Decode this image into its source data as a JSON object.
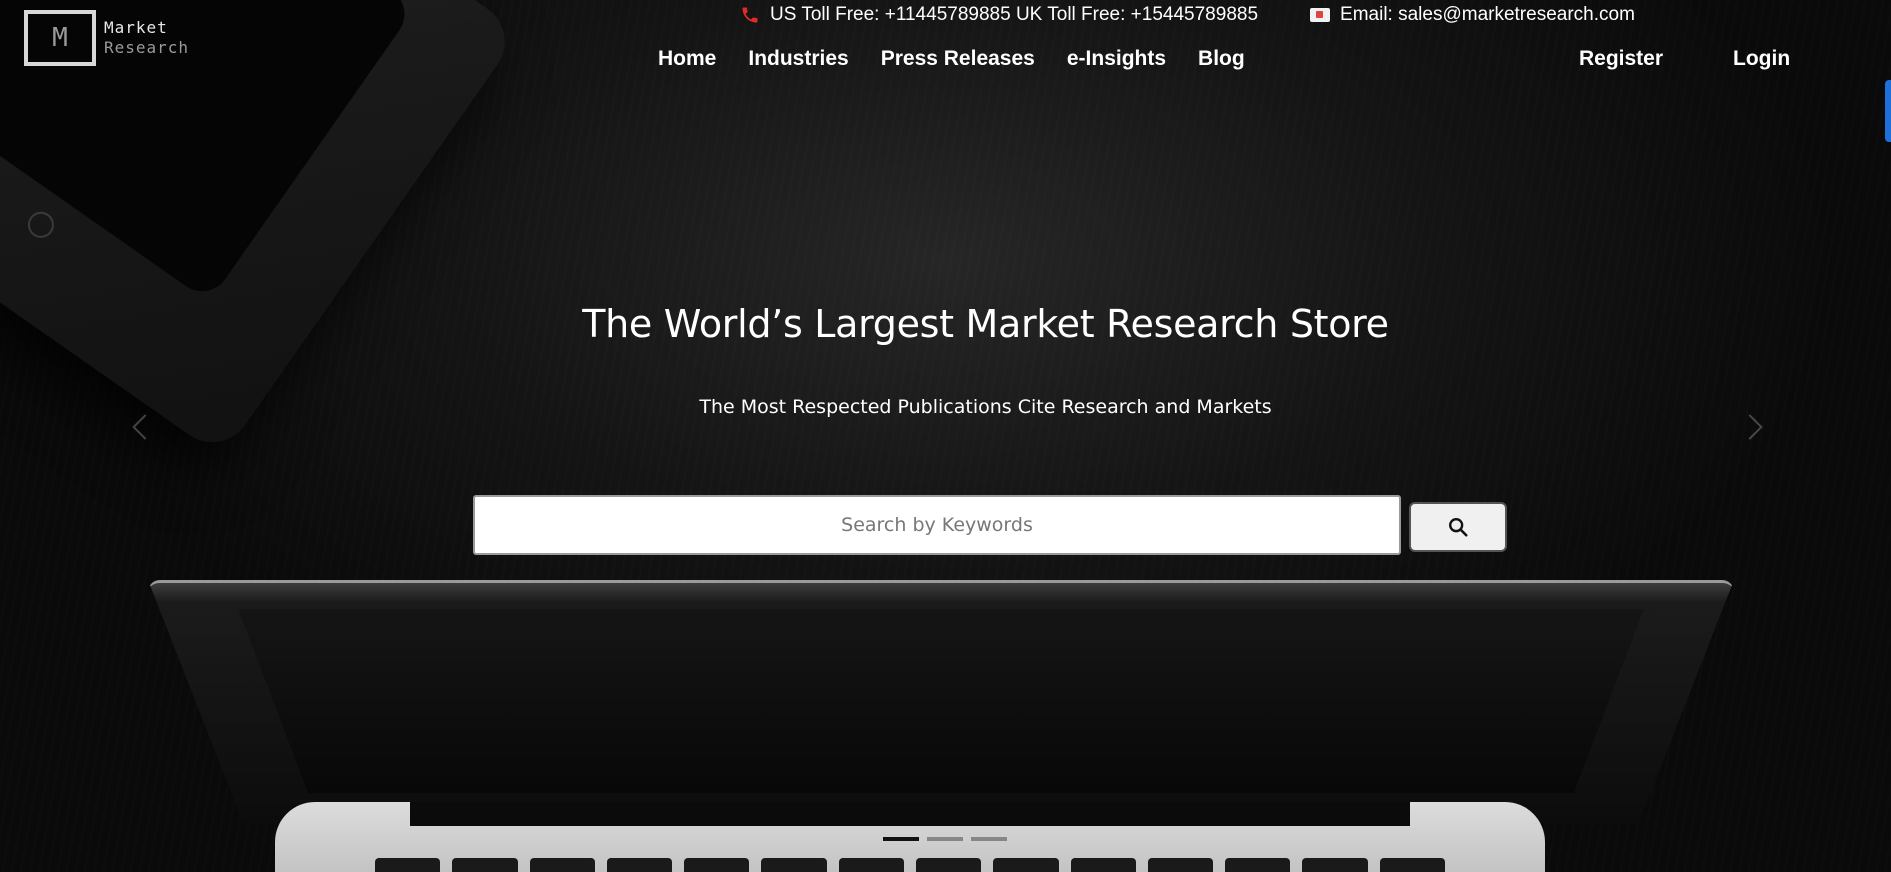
{
  "logo": {
    "letter": "M",
    "line1": "Market",
    "line2": "Research"
  },
  "topbar": {
    "phones": "US Toll Free: +11445789885 UK Toll Free: +15445789885",
    "email": "Email: sales@marketresearch.com"
  },
  "nav": {
    "items": [
      {
        "label": "Home"
      },
      {
        "label": "Industries"
      },
      {
        "label": "Press Releases"
      },
      {
        "label": "e-Insights"
      },
      {
        "label": "Blog"
      }
    ]
  },
  "auth": {
    "register": "Register",
    "login": "Login"
  },
  "hero": {
    "title": "The World’s Largest Market Research Store",
    "subtitle": "The Most Respected Publications Cite Research and Markets"
  },
  "search": {
    "placeholder": "Search by Keywords",
    "value": ""
  },
  "carousel": {
    "slide_count": 3,
    "active_index": 0
  },
  "icons": {
    "phone": "phone-icon",
    "mail": "mail-icon",
    "search": "search-icon",
    "prev": "chevron-left-icon",
    "next": "chevron-right-icon"
  },
  "colors": {
    "phone_icon": "#e02b2b",
    "side_tab": "#1e6fd9"
  }
}
